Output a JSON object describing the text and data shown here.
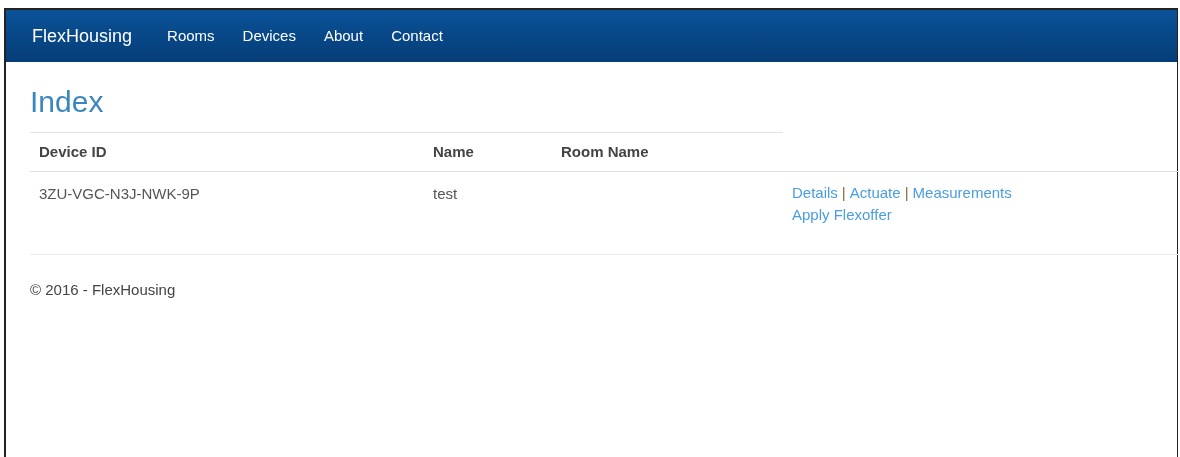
{
  "navbar": {
    "brand": "FlexHousing",
    "links": [
      "Rooms",
      "Devices",
      "About",
      "Contact"
    ]
  },
  "page_title": "Index",
  "table": {
    "columns": [
      "Device ID",
      "Name",
      "Room Name"
    ],
    "rows": [
      {
        "device_id": "3ZU-VGC-N3J-NWK-9P",
        "name": "test",
        "actions": [
          {
            "kind": "link",
            "text": "Details"
          },
          {
            "kind": "separator",
            "text": "|"
          },
          {
            "kind": "link",
            "text": "Actuate"
          },
          {
            "kind": "separator",
            "text": "|"
          },
          {
            "kind": "link",
            "text": "Measurements"
          },
          {
            "kind": "break"
          },
          {
            "kind": "link",
            "text": "Apply Flexoffer"
          }
        ]
      }
    ]
  },
  "footer": "© 2016 - FlexHousing"
}
